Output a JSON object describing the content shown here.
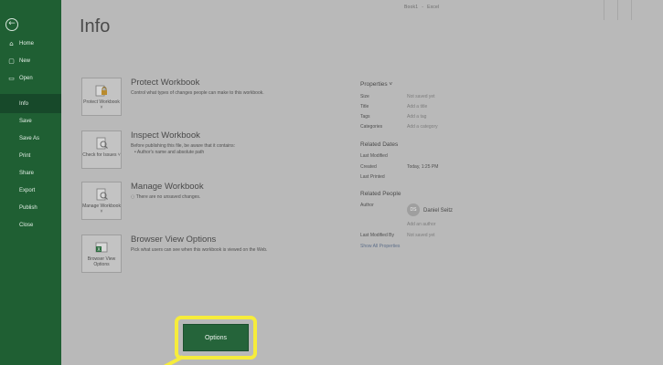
{
  "window": {
    "title_left": "Book1",
    "title_sep": "-",
    "title_right": "Excel"
  },
  "sidebar": {
    "back_icon": "back-arrow-icon",
    "items": [
      {
        "label": "Home",
        "icon": "home-icon",
        "glyph": "⌂"
      },
      {
        "label": "New",
        "icon": "new-file-icon",
        "glyph": "▢"
      },
      {
        "label": "Open",
        "icon": "folder-icon",
        "glyph": "▭"
      },
      {
        "label": "Info",
        "active": true
      },
      {
        "label": "Save"
      },
      {
        "label": "Save As"
      },
      {
        "label": "Print"
      },
      {
        "label": "Share"
      },
      {
        "label": "Export"
      },
      {
        "label": "Publish"
      },
      {
        "label": "Close"
      }
    ]
  },
  "page": {
    "title": "Info"
  },
  "sections": [
    {
      "tile_label": "Protect Workbook ˅",
      "icon": "lock-icon",
      "heading": "Protect Workbook",
      "description": "Control what types of changes people can make to this workbook."
    },
    {
      "tile_label": "Check for Issues ˅",
      "icon": "inspect-document-icon",
      "heading": "Inspect Workbook",
      "description": "Before publishing this file, be aware that it contains:",
      "bullet": "Author's name and absolute path"
    },
    {
      "tile_label": "Manage Workbook ˅",
      "icon": "manage-document-icon",
      "heading": "Manage Workbook",
      "description": "There are no unsaved changes."
    },
    {
      "tile_label": "Browser View Options",
      "icon": "excel-browser-icon",
      "heading": "Browser View Options",
      "description": "Pick what users can see when this workbook is viewed on the Web."
    }
  ],
  "properties": {
    "heading": "Properties ˅",
    "rows": [
      {
        "label": "Size",
        "value": "Not saved yet"
      },
      {
        "label": "Title",
        "value": "Add a title"
      },
      {
        "label": "Tags",
        "value": "Add a tag"
      },
      {
        "label": "Categories",
        "value": "Add a category"
      }
    ],
    "dates_heading": "Related Dates",
    "dates": [
      {
        "label": "Last Modified",
        "value": ""
      },
      {
        "label": "Created",
        "value": "Today, 1:25 PM"
      },
      {
        "label": "Last Printed",
        "value": ""
      }
    ],
    "people_heading": "Related People",
    "author_label": "Author",
    "author_initials": "DS",
    "author_name": "Daniel Seitz",
    "add_author": "Add an author",
    "last_modified_by_label": "Last Modified By",
    "last_modified_by_value": "Not saved yet",
    "show_all": "Show All Properties"
  },
  "options": {
    "label": "Options",
    "highlight_color": "#f6ec3b"
  },
  "colors": {
    "sidebar": "#1f5f33",
    "accent_green": "#25643a"
  }
}
